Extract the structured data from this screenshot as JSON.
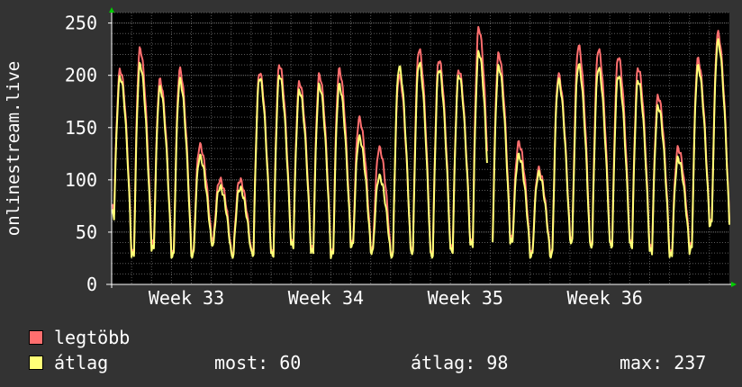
{
  "chart_data": {
    "type": "line",
    "ylabel": "onlinestream.live",
    "ylim": [
      0,
      260
    ],
    "y_ticks": [
      0,
      50,
      100,
      150,
      200,
      250
    ],
    "x_ticks": [
      "Week 33",
      "Week 34",
      "Week 35",
      "Week 36"
    ],
    "grid": true,
    "colors": {
      "background": "#000000",
      "page": "#333333",
      "grid": "#5a5a5a",
      "axis": "#ffffff",
      "max_series": "#ff6f6f",
      "avg_series": "#ffff77",
      "arrow": "#00cc00"
    },
    "series": [
      {
        "name": "legtöbb",
        "daily_peaks": [
          205,
          225,
          195,
          205,
          133,
          100,
          100,
          203,
          210,
          193,
          200,
          205,
          158,
          130,
          200,
          225,
          215,
          205,
          245,
          220,
          135,
          110,
          200,
          228,
          225,
          218,
          207,
          180,
          130,
          215,
          240
        ],
        "daily_troughs": [
          75,
          30,
          40,
          30,
          30,
          45,
          30,
          32,
          30,
          40,
          35,
          30,
          40,
          35,
          30,
          35,
          30,
          35,
          40,
          45,
          45,
          30,
          30,
          45,
          40,
          40,
          40,
          35,
          30,
          35,
          60
        ]
      },
      {
        "name": "átlag",
        "daily_peaks": [
          198,
          210,
          188,
          195,
          122,
          93,
          92,
          198,
          200,
          185,
          190,
          190,
          140,
          103,
          208,
          212,
          206,
          200,
          222,
          208,
          123,
          106,
          195,
          210,
          207,
          200,
          195,
          170,
          120,
          208,
          232
        ],
        "daily_troughs": [
          70,
          28,
          35,
          28,
          28,
          40,
          28,
          30,
          28,
          38,
          32,
          28,
          38,
          32,
          28,
          32,
          28,
          32,
          38,
          42,
          42,
          28,
          28,
          42,
          38,
          38,
          38,
          32,
          28,
          32,
          58
        ]
      }
    ],
    "gaps_days": [
      [
        18.85,
        19.1
      ]
    ],
    "days_total": 31,
    "week_tick_days": [
      3.75,
      10.75,
      17.75,
      24.75
    ],
    "summary": {
      "most_label": "most:",
      "most_value": "60",
      "avg_label": "átlag:",
      "avg_value": "98",
      "max_label": "max:",
      "max_value": "237"
    }
  },
  "legend": {
    "max_label": "legtöbb",
    "avg_label": "átlag"
  }
}
